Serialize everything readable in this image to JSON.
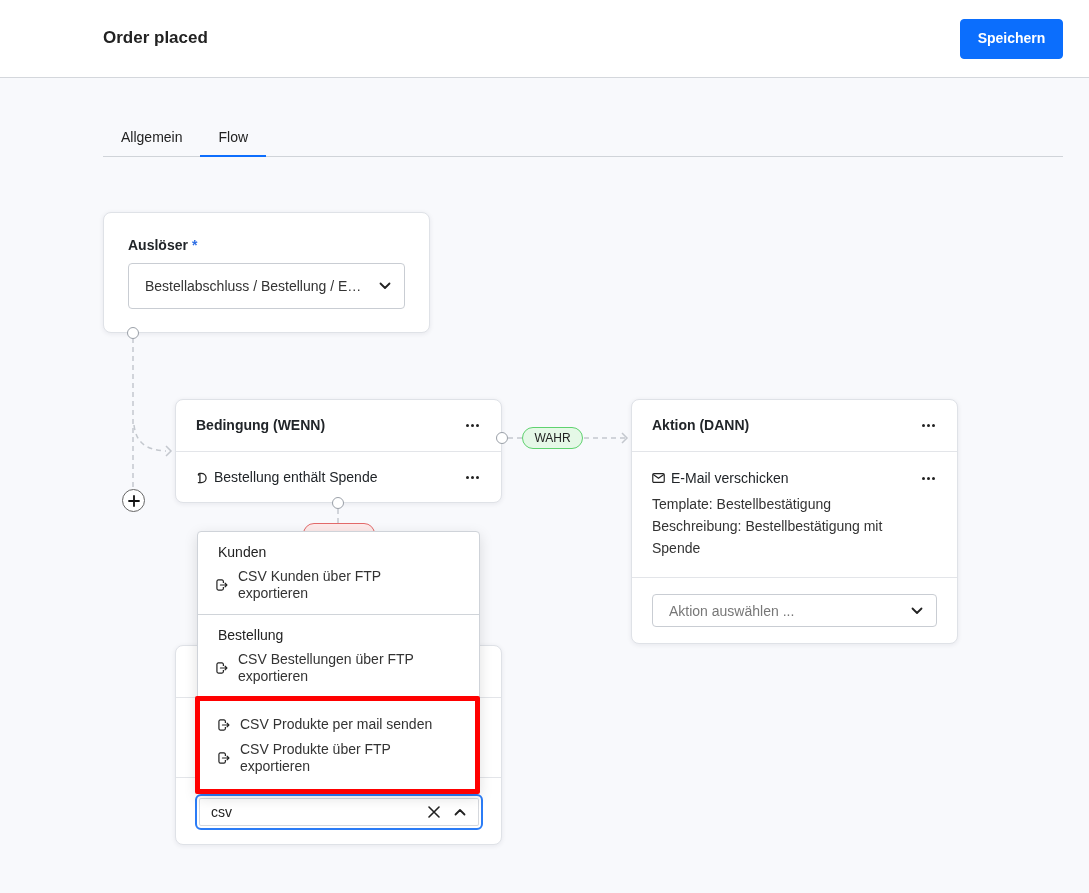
{
  "header": {
    "title": "Order placed",
    "save_label": "Speichern"
  },
  "tabs": [
    {
      "label": "Allgemein",
      "selected": false
    },
    {
      "label": "Flow",
      "selected": true
    }
  ],
  "flow": {
    "trigger": {
      "label": "Auslöser",
      "required_mark": "*",
      "value": "Bestellabschluss / Bestellung / E…"
    },
    "condition": {
      "title": "Bedingung (WENN)",
      "rules": [
        {
          "text": "Bestellung enthält Spende"
        }
      ]
    },
    "branches": [
      {
        "kind": "true",
        "label": "WAHR"
      },
      {
        "kind": "false"
      }
    ],
    "action": {
      "title": "Aktion (DANN)",
      "steps": [
        {
          "kind": "email",
          "title": "E-Mail verschicken",
          "details": [
            "Template: Bestellbestätigung",
            "Beschreibung: Bestellbestätigung mit Spende"
          ]
        }
      ],
      "select": {
        "placeholder": "Aktion auswählen ..."
      }
    },
    "new_step": {
      "search": {
        "value": "csv"
      },
      "dropdown": {
        "groups": [
          {
            "label": "Kunden",
            "highlighted": false,
            "items": [
              "CSV Kunden über FTP exportieren"
            ]
          },
          {
            "label": "Bestellung",
            "highlighted": false,
            "items": [
              "CSV Bestellungen über FTP exportieren"
            ]
          },
          {
            "highlighted": true,
            "items": [
              "CSV Produkte per mail senden",
              "CSV Produkte über FTP exportieren"
            ]
          }
        ]
      }
    }
  }
}
